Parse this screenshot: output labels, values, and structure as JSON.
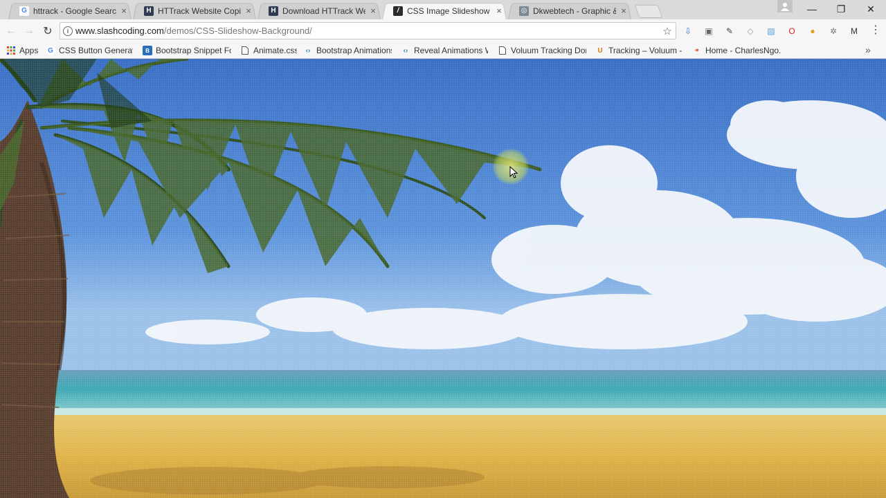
{
  "tabs": [
    {
      "title": "httrack - Google Search",
      "favicon": "google-icon",
      "active": false
    },
    {
      "title": "HTTrack Website Copier",
      "favicon": "httrack-icon",
      "active": false
    },
    {
      "title": "Download HTTrack Web",
      "favicon": "httrack-icon",
      "active": false
    },
    {
      "title": "CSS Image Slideshow Ba",
      "favicon": "slashcoding-icon",
      "active": true
    },
    {
      "title": "Dkwebtech - Graphic &",
      "favicon": "dkwebtech-icon",
      "active": false
    }
  ],
  "tab_close_glyph": "×",
  "window_controls": {
    "minimize": "—",
    "restore": "❐",
    "close": "✕"
  },
  "toolbar": {
    "back": "←",
    "forward": "→",
    "reload": "↻",
    "url_host": "www.slashcoding.com",
    "url_path": "/demos/CSS-Slideshow-Background/",
    "star": "☆",
    "menu": "⋮"
  },
  "extensions": [
    {
      "name": "extension-1-icon",
      "glyph": "⇩",
      "color": "#3a6fd8"
    },
    {
      "name": "extension-2-icon",
      "glyph": "▣",
      "color": "#666666"
    },
    {
      "name": "eyedropper-icon",
      "glyph": "✎",
      "color": "#444444"
    },
    {
      "name": "tag-icon",
      "glyph": "◇",
      "color": "#999999"
    },
    {
      "name": "image-icon",
      "glyph": "▨",
      "color": "#5aa0d8"
    },
    {
      "name": "opera-icon",
      "glyph": "O",
      "color": "#e02020"
    },
    {
      "name": "color-wheel-icon",
      "glyph": "●",
      "color": "#e0a020"
    },
    {
      "name": "settings-icon",
      "glyph": "✲",
      "color": "#777777"
    },
    {
      "name": "gmail-icon",
      "glyph": "M",
      "color": "#333333"
    }
  ],
  "bookmarks": [
    {
      "label": "Apps",
      "icon": "apps-icon"
    },
    {
      "label": "CSS Button Generato",
      "icon": "google-icon"
    },
    {
      "label": "Bootstrap Snippet Fo",
      "icon": "bootsnipp-icon"
    },
    {
      "label": "Animate.css",
      "icon": "page-icon"
    },
    {
      "label": "Bootstrap Animations",
      "icon": "code-icon"
    },
    {
      "label": "Reveal Animations W",
      "icon": "code-icon"
    },
    {
      "label": "Voluum Tracking Don",
      "icon": "page-icon"
    },
    {
      "label": "Tracking – Voluum - C",
      "icon": "voluum-icon"
    },
    {
      "label": "Home - CharlesNgo.c",
      "icon": "charlesngo-icon"
    }
  ],
  "bookmarks_overflow": "»"
}
